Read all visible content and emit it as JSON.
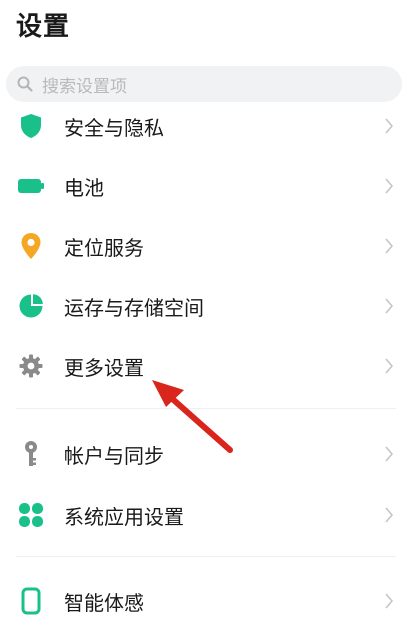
{
  "header": {
    "title": "设置"
  },
  "search": {
    "placeholder": "搜索设置项",
    "icon": "search-icon"
  },
  "groups": [
    {
      "items": [
        {
          "label": "安全与隐私",
          "icon": "shield-icon",
          "color": "#19c08a"
        },
        {
          "label": "电池",
          "icon": "battery-icon",
          "color": "#19c08a"
        },
        {
          "label": "定位服务",
          "icon": "location-pin-icon",
          "color": "#f5a623"
        },
        {
          "label": "运存与存储空间",
          "icon": "pie-chart-icon",
          "color": "#19c08a"
        },
        {
          "label": "更多设置",
          "icon": "gear-icon",
          "color": "#8a8a8a"
        }
      ]
    },
    {
      "items": [
        {
          "label": "帐户与同步",
          "icon": "key-icon",
          "color": "#8a8a8a"
        },
        {
          "label": "系统应用设置",
          "icon": "apps-grid-icon",
          "color": "#19c08a"
        }
      ]
    },
    {
      "items": [
        {
          "label": "智能体感",
          "icon": "phone-icon",
          "color": "#19c08a"
        }
      ]
    }
  ],
  "annotation": {
    "icon": "red-arrow-icon",
    "color": "#d9251c"
  }
}
